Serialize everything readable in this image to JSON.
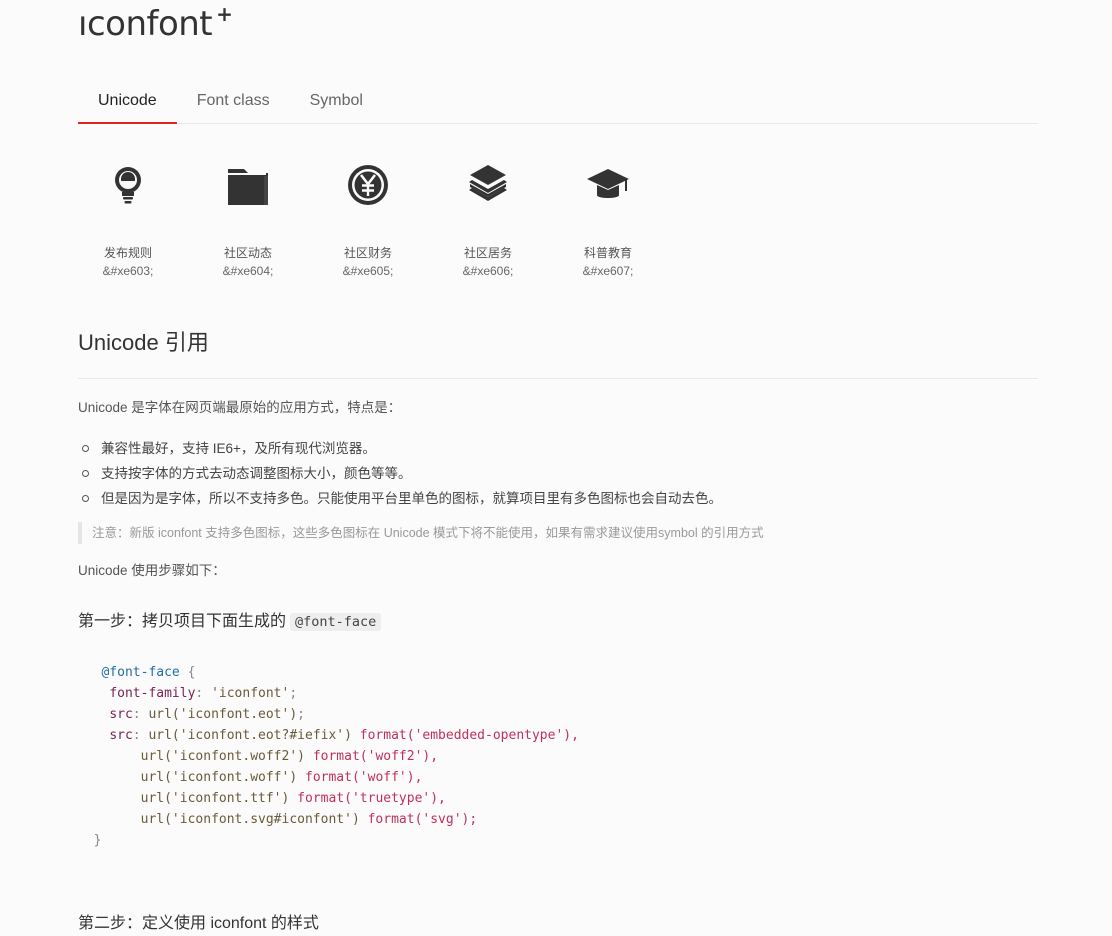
{
  "logo": {
    "text": "ıconfont",
    "plus": "+"
  },
  "tabs": [
    {
      "label": "Unicode",
      "active": true
    },
    {
      "label": "Font class",
      "active": false
    },
    {
      "label": "Symbol",
      "active": false
    }
  ],
  "icons": [
    {
      "icon": "lightbulb-icon",
      "name": "发布规则",
      "code": "&#xe603;"
    },
    {
      "icon": "folder-icon",
      "name": "社区动态",
      "code": "&#xe604;"
    },
    {
      "icon": "yen-coin-icon",
      "name": "社区财务",
      "code": "&#xe605;"
    },
    {
      "icon": "layers-icon",
      "name": "社区居务",
      "code": "&#xe606;"
    },
    {
      "icon": "graduation-cap-icon",
      "name": "科普教育",
      "code": "&#xe607;"
    }
  ],
  "section": {
    "title": "Unicode 引用",
    "intro": "Unicode 是字体在网页端最原始的应用方式，特点是：",
    "features": [
      "兼容性最好，支持 IE6+，及所有现代浏览器。",
      "支持按字体的方式去动态调整图标大小，颜色等等。",
      "但是因为是字体，所以不支持多色。只能使用平台里单色的图标，就算项目里有多色图标也会自动去色。"
    ],
    "note": "注意：新版 iconfont 支持多色图标，这些多色图标在 Unicode 模式下将不能使用，如果有需求建议使用symbol 的引用方式",
    "steps_intro": "Unicode 使用步骤如下：",
    "step1_text": "第一步：拷贝项目下面生成的",
    "step1_code": "@font-face",
    "step2_text": "第二步：定义使用 iconfont 的样式"
  },
  "code": {
    "at_rule": "@font-face",
    "brace_open": "{",
    "brace_close": "}",
    "family_prop": "font-family",
    "family_value": "'iconfont'",
    "src_prop": "src",
    "src1": "url('iconfont.eot')",
    "src2_url": "url('iconfont.eot?#iefix')",
    "src2_fmt": "format('embedded-opentype'),",
    "src3_url": "url('iconfont.woff2')",
    "src3_fmt": "format('woff2'),",
    "src4_url": "url('iconfont.woff')",
    "src4_fmt": "format('woff'),",
    "src5_url": "url('iconfont.ttf')",
    "src5_fmt": "format('truetype'),",
    "src6_url": "url('iconfont.svg#iconfont')",
    "src6_fmt": "format('svg');"
  }
}
